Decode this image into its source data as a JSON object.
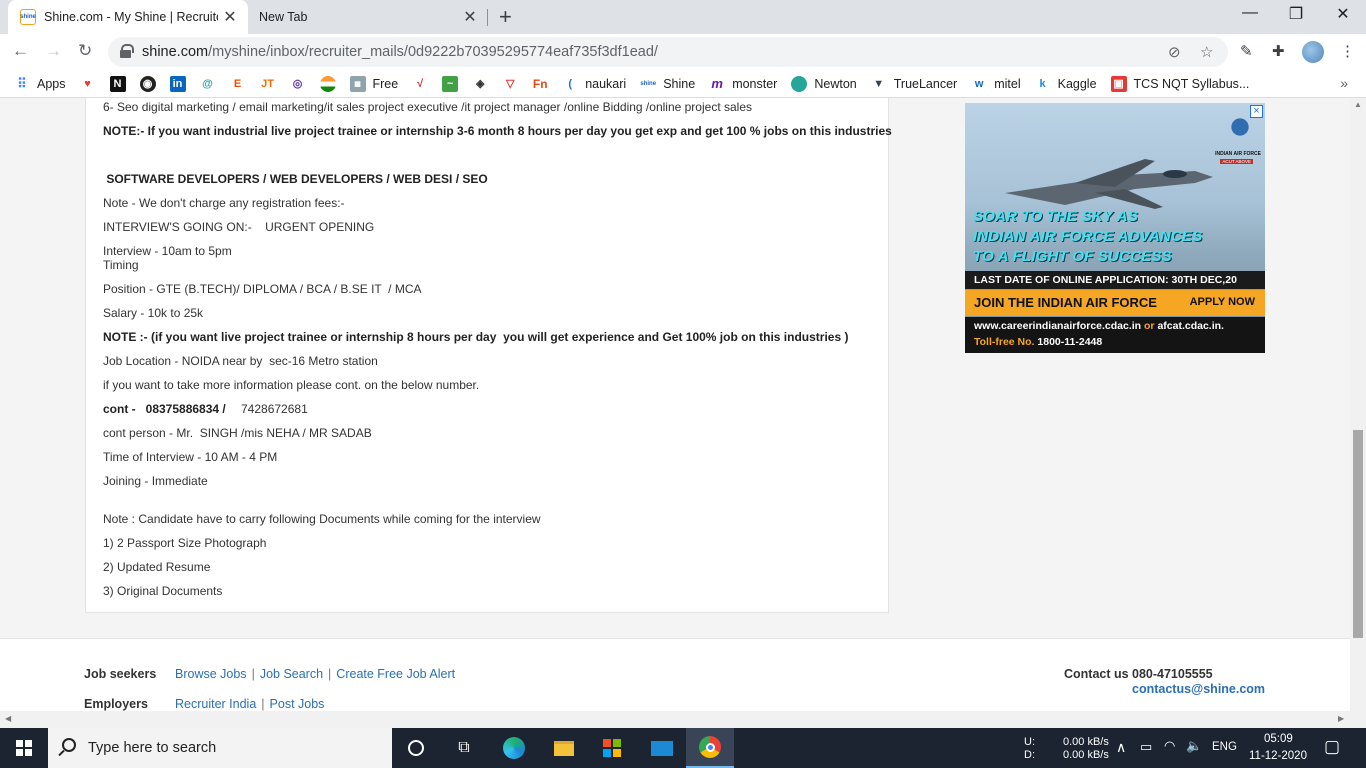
{
  "browser": {
    "tabs": [
      {
        "title": "Shine.com - My Shine | Recruiter",
        "favicon": "shine"
      },
      {
        "title": "New Tab"
      }
    ],
    "url_host": "shine.com",
    "url_path": "/myshine/inbox/recruiter_mails/0d9222b70395295774eaf735f3df1ead/"
  },
  "bookmarks": [
    {
      "label": "Apps",
      "icon": "apps-grid-icon"
    },
    {
      "label": "",
      "icon": "heart-icon"
    },
    {
      "label": "",
      "icon": "n-logo-icon"
    },
    {
      "label": "",
      "icon": "github-icon"
    },
    {
      "label": "",
      "icon": "linkedin-icon"
    },
    {
      "label": "",
      "icon": "spiral-icon"
    },
    {
      "label": "",
      "icon": "e-logo-icon"
    },
    {
      "label": "",
      "icon": "jt-logo-icon"
    },
    {
      "label": "",
      "icon": "globe-icon"
    },
    {
      "label": "",
      "icon": "flag-icon"
    },
    {
      "label": "Free",
      "icon": "free-icon"
    },
    {
      "label": "",
      "icon": "red-check-icon"
    },
    {
      "label": "",
      "icon": "green-wave-icon"
    },
    {
      "label": "",
      "icon": "diamond-icon"
    },
    {
      "label": "",
      "icon": "triangle-icon"
    },
    {
      "label": "",
      "icon": "fn-logo-icon"
    },
    {
      "label": "naukari",
      "icon": "naukri-icon"
    },
    {
      "label": "Shine",
      "icon": "shine-icon"
    },
    {
      "label": "monster",
      "icon": "monster-icon"
    },
    {
      "label": "Newton",
      "icon": "newton-icon"
    },
    {
      "label": "TrueLancer",
      "icon": "truelancer-icon"
    },
    {
      "label": "mitel",
      "icon": "mitel-icon"
    },
    {
      "label": "Kaggle",
      "icon": "kaggle-icon"
    },
    {
      "label": "TCS NQT Syllabus...",
      "icon": "tcs-icon"
    }
  ],
  "mail": {
    "lines": [
      {
        "text": "6- Seo digital marketing / email marketing/it sales project executive /it project manager /online Bidding /online project sales",
        "bold": false
      },
      {
        "text": "NOTE:- If you want industrial live project trainee or internship 3-6 month 8 hours per day you get exp and get 100 % jobs on this industries",
        "bold": true
      },
      {
        "text": " SOFTWARE DEVELOPERS / WEB DEVELOPERS / WEB DESI / SEO",
        "bold": true
      },
      {
        "text": "Note - We don't charge any registration fees:-",
        "bold": false
      },
      {
        "text": "INTERVIEW'S GOING ON:-    URGENT OPENING",
        "bold": false
      },
      {
        "text": "Interview - 10am to 5pm",
        "bold": false
      },
      {
        "text": "Timing",
        "bold": false
      },
      {
        "text": "Position - GTE (B.TECH)/ DIPLOMA / BCA / B.SE IT  / MCA",
        "bold": false
      },
      {
        "text": "Salary - 10k to 25k",
        "bold": false
      },
      {
        "text": "NOTE :- (if you want live project trainee or internship 8 hours per day  you will get experience and Get 100% job on this industries )",
        "bold": true
      },
      {
        "text": "Job Location - NOIDA near by  sec-16 Metro station",
        "bold": false
      },
      {
        "text": "if you want to take more information please cont. on the below number.",
        "bold": false
      },
      {
        "text": "cont -   08375886834 /",
        "bold": true
      },
      {
        "text": "7428672681",
        "bold": false
      },
      {
        "text": "cont person - Mr.  SINGH /mis NEHA / MR SADAB",
        "bold": false
      },
      {
        "text": "Time of Interview - 10 AM - 4 PM",
        "bold": false
      },
      {
        "text": "Joining - Immediate",
        "bold": false
      },
      {
        "text": "Note : Candidate have to carry following Documents while coming for the interview",
        "bold": false
      },
      {
        "text": "1) 2 Passport Size Photograph",
        "bold": false
      },
      {
        "text": "2) Updated Resume",
        "bold": false
      },
      {
        "text": "3) Original Documents",
        "bold": false
      }
    ]
  },
  "ad": {
    "headline_1": "SOAR TO THE SKY AS",
    "headline_2": "INDIAN AIR FORCE ADVANCES",
    "headline_3": "TO A FLIGHT OF SUCCESS",
    "last_date": "LAST DATE OF ONLINE APPLICATION: 30TH DEC,20",
    "join": "JOIN THE INDIAN AIR FORCE",
    "apply": "APPLY NOW",
    "site_1": "www.careerindianairforce.cdac.in",
    "or": "or",
    "site_2": "afcat.cdac.in.",
    "tollfree_label": "Toll-free No.",
    "tollfree": "1800-11-2448",
    "crest_text": "INDIAN AIR FORCE",
    "crest_sub": "ACUT ABOVE",
    "close": "×"
  },
  "footer": {
    "job_seekers_label": "Job seekers",
    "job_seekers_links": [
      "Browse Jobs",
      "Job Search",
      "Create Free Job Alert"
    ],
    "employers_label": "Employers",
    "employers_links": [
      "Recruiter India",
      "Post Jobs"
    ],
    "contact_label": "Contact us",
    "phone": "080-47105555",
    "email": "contactus@shine.com"
  },
  "taskbar": {
    "search_placeholder": "Type here to search",
    "net_up_label": "U:",
    "net_down_label": "D:",
    "net_up": "0.00 kB/s",
    "net_down": "0.00 kB/s",
    "language": "ENG",
    "time": "05:09",
    "date": "11-12-2020"
  }
}
